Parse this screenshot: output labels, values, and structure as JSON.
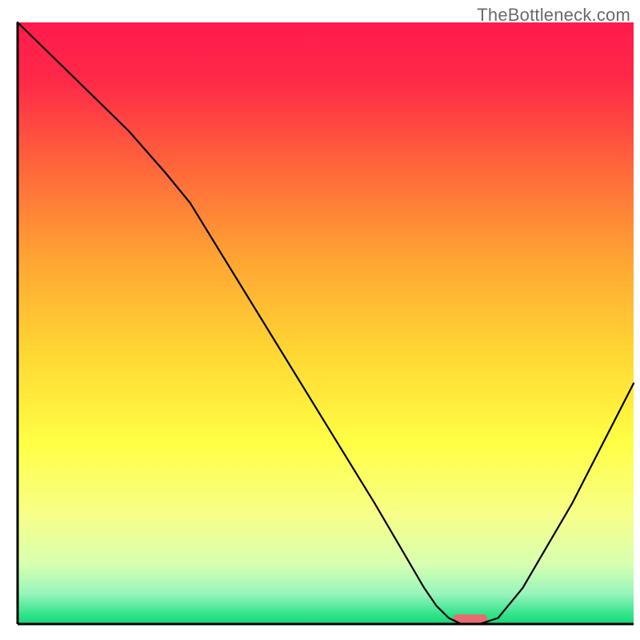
{
  "watermark": "TheBottleneck.com",
  "chart_data": {
    "type": "line",
    "title": "",
    "xlabel": "",
    "ylabel": "",
    "xlim": [
      0,
      100
    ],
    "ylim": [
      0,
      100
    ],
    "background_gradient_stops": [
      {
        "offset": 0.0,
        "color": "#ff1a4d"
      },
      {
        "offset": 0.1,
        "color": "#ff2a48"
      },
      {
        "offset": 0.25,
        "color": "#ff6a3a"
      },
      {
        "offset": 0.4,
        "color": "#ffa733"
      },
      {
        "offset": 0.55,
        "color": "#ffd733"
      },
      {
        "offset": 0.7,
        "color": "#ffff45"
      },
      {
        "offset": 0.82,
        "color": "#f7ff8a"
      },
      {
        "offset": 0.9,
        "color": "#d8ffb0"
      },
      {
        "offset": 0.95,
        "color": "#96f5bc"
      },
      {
        "offset": 0.985,
        "color": "#2fe28a"
      },
      {
        "offset": 1.0,
        "color": "#17d877"
      }
    ],
    "series": [
      {
        "name": "bottleneck-curve",
        "color": "#000000",
        "width": 2.2,
        "x": [
          0,
          6,
          12,
          18,
          24,
          28,
          34,
          40,
          46,
          52,
          58,
          62,
          66,
          68,
          70,
          72,
          75,
          78,
          82,
          86,
          90,
          94,
          98,
          100
        ],
        "y": [
          100,
          94,
          88,
          82,
          75,
          70,
          60,
          50,
          40,
          30,
          20,
          13,
          6,
          3,
          1,
          0,
          0,
          1,
          6,
          13,
          20,
          28,
          36,
          40
        ]
      }
    ],
    "marker": {
      "name": "optimal-marker",
      "x_center": 73.5,
      "width": 5.5,
      "color": "#e96a6f"
    }
  }
}
